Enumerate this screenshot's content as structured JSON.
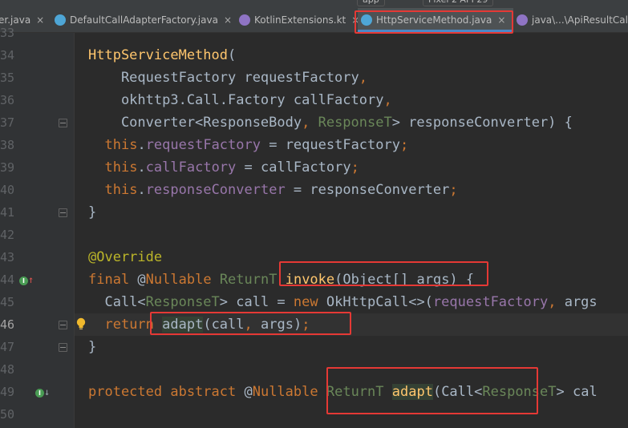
{
  "top_partial": [
    "app",
    "Pixel 2 API 29"
  ],
  "tabs": [
    {
      "label": "er.java",
      "active": false,
      "icon_color": "#e8a33d"
    },
    {
      "label": "DefaultCallAdapterFactory.java",
      "active": false,
      "icon_color": "#4ea6d6"
    },
    {
      "label": "KotlinExtensions.kt",
      "active": false,
      "icon_color": "#8f74c4"
    },
    {
      "label": "HttpServiceMethod.java",
      "active": true,
      "icon_color": "#4ea6d6"
    },
    {
      "label": "java\\...\\ApiResultCallA",
      "active": false,
      "icon_color": "#8f74c4"
    }
  ],
  "gutter": {
    "line_numbers": [
      "33",
      "34",
      "35",
      "36",
      "37",
      "38",
      "39",
      "40",
      "41",
      "42",
      "43",
      "44",
      "45",
      "46",
      "47",
      "48",
      "49",
      "50"
    ],
    "icons": [
      "override-icon",
      "implemented-icon",
      "lightbulb-icon",
      "fold-icon"
    ]
  },
  "code": {
    "lines": [
      [],
      [
        [
          "HttpServiceMethod",
          "mth"
        ],
        [
          "(",
          ""
        ]
      ],
      [
        [
          "    RequestFactory requestFactory",
          ""
        ],
        [
          ",",
          "kw"
        ]
      ],
      [
        [
          "    okhttp3.Call.Factory callFactory",
          ""
        ],
        [
          ",",
          "kw"
        ]
      ],
      [
        [
          "    Converter<ResponseBody",
          ""
        ],
        [
          ", ",
          "kw"
        ],
        [
          "ResponseT",
          "typ"
        ],
        [
          "> responseConverter) {",
          ""
        ]
      ],
      [
        [
          "  ",
          ""
        ],
        [
          "this",
          "kw"
        ],
        [
          ".",
          ""
        ],
        [
          "requestFactory",
          "fld"
        ],
        [
          " = requestFactory",
          ""
        ],
        [
          ";",
          "kw"
        ]
      ],
      [
        [
          "  ",
          ""
        ],
        [
          "this",
          "kw"
        ],
        [
          ".",
          ""
        ],
        [
          "callFactory",
          "fld"
        ],
        [
          " = callFactory",
          ""
        ],
        [
          ";",
          "kw"
        ]
      ],
      [
        [
          "  ",
          ""
        ],
        [
          "this",
          "kw"
        ],
        [
          ".",
          ""
        ],
        [
          "responseConverter",
          "fld"
        ],
        [
          " = responseConverter",
          ""
        ],
        [
          ";",
          "kw"
        ]
      ],
      [
        [
          "}",
          ""
        ]
      ],
      [],
      [
        [
          "@Override",
          "ann"
        ]
      ],
      [
        [
          "final ",
          "kw"
        ],
        [
          "@",
          ""
        ],
        [
          "Nullable",
          "kw"
        ],
        [
          " ",
          ""
        ],
        [
          "ReturnT",
          "typ"
        ],
        [
          " ",
          ""
        ],
        [
          "invoke",
          "mth"
        ],
        [
          "(Object[] args) {",
          ""
        ]
      ],
      [
        [
          "  Call<",
          ""
        ],
        [
          "ResponseT",
          "typ"
        ],
        [
          "> call = ",
          ""
        ],
        [
          "new ",
          "kw"
        ],
        [
          "OkHttpCall<>(",
          ""
        ],
        [
          "requestFactory",
          "fld"
        ],
        [
          ", ",
          "kw"
        ],
        [
          "args",
          ""
        ]
      ],
      [
        [
          "  ",
          ""
        ],
        [
          "return ",
          "kw"
        ],
        [
          "adapt",
          "hl"
        ],
        [
          "(call",
          ""
        ],
        [
          ", ",
          "kw"
        ],
        [
          "args)",
          ""
        ],
        [
          ";",
          "kw"
        ]
      ],
      [
        [
          "}",
          ""
        ]
      ],
      [],
      [
        [
          "protected abstract ",
          "kw"
        ],
        [
          "@",
          ""
        ],
        [
          "Nullable",
          "kw"
        ],
        [
          " ",
          ""
        ],
        [
          "ReturnT",
          "typ"
        ],
        [
          " ",
          ""
        ],
        [
          "adapt",
          "mth hl"
        ],
        [
          "(Call<",
          ""
        ],
        [
          "ResponseT",
          "typ"
        ],
        [
          "> cal",
          ""
        ]
      ],
      []
    ]
  },
  "colors": {
    "keyword": "#cc7832",
    "field": "#9876aa",
    "annotation": "#bbb529",
    "type_param": "#6a8759",
    "method_decl": "#ffc66d",
    "default_text": "#a9b7c6",
    "highlight_box": "#e53935"
  }
}
